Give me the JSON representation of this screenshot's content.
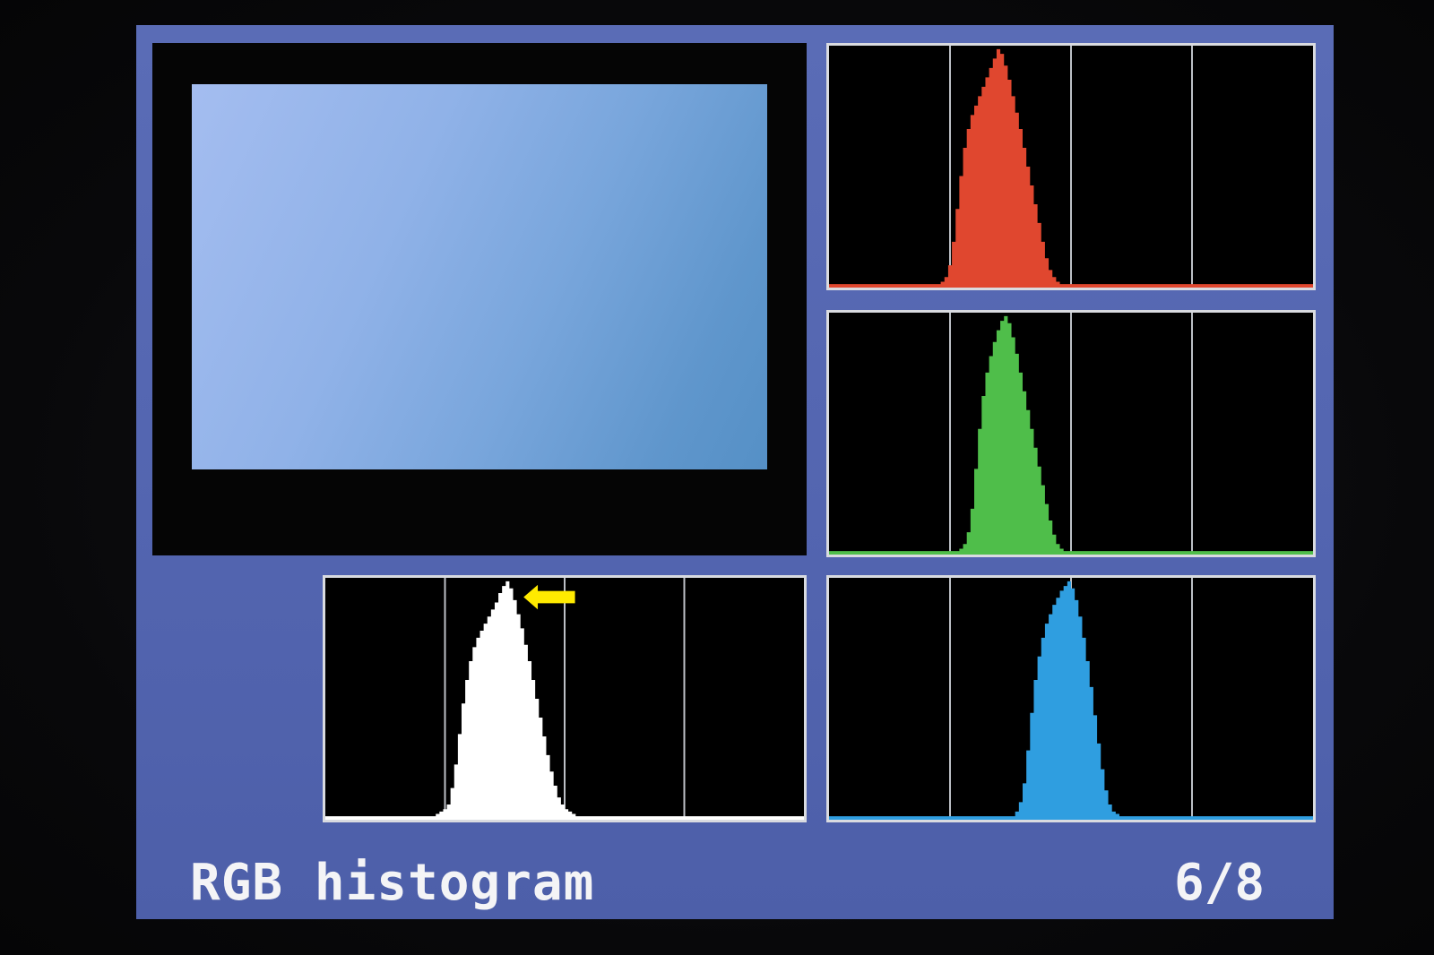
{
  "screen": {
    "title": "RGB histogram",
    "page_indicator": "6/8"
  },
  "colors": {
    "screen_bg": "#5565b0",
    "luminance": "#ffffff",
    "red": "#e0472f",
    "green": "#4fbe4a",
    "blue": "#2f9ee0",
    "peak_marker": "#ffea00",
    "gridline": "#bfc2c8",
    "panel_border": "#d9dbe0"
  },
  "histograms": [
    {
      "channel": "luminance",
      "color": "#ffffff",
      "bins": [
        0,
        0,
        0,
        0,
        0,
        0,
        0,
        0,
        0,
        0,
        0,
        0,
        0,
        0,
        0,
        0,
        0,
        0,
        0,
        0,
        0,
        0,
        0,
        0,
        0,
        0,
        0,
        0,
        0,
        0,
        0.01,
        0.02,
        0.03,
        0.05,
        0.12,
        0.22,
        0.35,
        0.48,
        0.58,
        0.66,
        0.72,
        0.76,
        0.79,
        0.82,
        0.85,
        0.88,
        0.91,
        0.95,
        0.98,
        1.0,
        0.97,
        0.92,
        0.86,
        0.8,
        0.73,
        0.66,
        0.58,
        0.5,
        0.42,
        0.34,
        0.26,
        0.19,
        0.13,
        0.08,
        0.05,
        0.03,
        0.02,
        0.01,
        0,
        0,
        0,
        0,
        0,
        0,
        0,
        0,
        0,
        0,
        0,
        0,
        0,
        0,
        0,
        0,
        0,
        0,
        0,
        0,
        0,
        0,
        0,
        0,
        0,
        0,
        0,
        0,
        0,
        0,
        0,
        0,
        0,
        0,
        0,
        0,
        0,
        0,
        0,
        0,
        0,
        0,
        0,
        0,
        0,
        0,
        0,
        0,
        0,
        0,
        0,
        0,
        0,
        0,
        0,
        0,
        0,
        0,
        0,
        0,
        0,
        0
      ]
    },
    {
      "channel": "red",
      "color": "#e0472f",
      "bins": [
        0,
        0,
        0,
        0,
        0,
        0,
        0,
        0,
        0,
        0,
        0,
        0,
        0,
        0,
        0,
        0,
        0,
        0,
        0,
        0,
        0,
        0,
        0,
        0,
        0,
        0,
        0,
        0,
        0,
        0,
        0.01,
        0.03,
        0.08,
        0.18,
        0.32,
        0.46,
        0.58,
        0.66,
        0.72,
        0.76,
        0.8,
        0.84,
        0.88,
        0.92,
        0.96,
        1.0,
        0.98,
        0.93,
        0.87,
        0.8,
        0.73,
        0.66,
        0.58,
        0.5,
        0.42,
        0.34,
        0.26,
        0.18,
        0.11,
        0.06,
        0.03,
        0.01,
        0,
        0,
        0,
        0,
        0,
        0,
        0,
        0,
        0,
        0,
        0,
        0,
        0,
        0,
        0,
        0,
        0,
        0,
        0,
        0,
        0,
        0,
        0,
        0,
        0,
        0,
        0,
        0,
        0,
        0,
        0,
        0,
        0,
        0,
        0,
        0,
        0,
        0,
        0,
        0,
        0,
        0,
        0,
        0,
        0,
        0,
        0,
        0,
        0,
        0,
        0,
        0,
        0,
        0,
        0,
        0,
        0,
        0,
        0,
        0,
        0,
        0,
        0,
        0,
        0,
        0,
        0,
        0
      ]
    },
    {
      "channel": "green",
      "color": "#4fbe4a",
      "bins": [
        0,
        0,
        0,
        0,
        0,
        0,
        0,
        0,
        0,
        0,
        0,
        0,
        0,
        0,
        0,
        0,
        0,
        0,
        0,
        0,
        0,
        0,
        0,
        0,
        0,
        0,
        0,
        0,
        0,
        0,
        0,
        0,
        0,
        0,
        0,
        0.01,
        0.03,
        0.08,
        0.18,
        0.35,
        0.52,
        0.66,
        0.76,
        0.83,
        0.89,
        0.94,
        0.98,
        1.0,
        0.97,
        0.91,
        0.84,
        0.76,
        0.68,
        0.6,
        0.52,
        0.44,
        0.36,
        0.28,
        0.2,
        0.13,
        0.07,
        0.03,
        0.01,
        0,
        0,
        0,
        0,
        0,
        0,
        0,
        0,
        0,
        0,
        0,
        0,
        0,
        0,
        0,
        0,
        0,
        0,
        0,
        0,
        0,
        0,
        0,
        0,
        0,
        0,
        0,
        0,
        0,
        0,
        0,
        0,
        0,
        0,
        0,
        0,
        0,
        0,
        0,
        0,
        0,
        0,
        0,
        0,
        0,
        0,
        0,
        0,
        0,
        0,
        0,
        0,
        0,
        0,
        0,
        0,
        0,
        0,
        0,
        0,
        0,
        0,
        0,
        0,
        0,
        0,
        0
      ]
    },
    {
      "channel": "blue",
      "color": "#2f9ee0",
      "bins": [
        0,
        0,
        0,
        0,
        0,
        0,
        0,
        0,
        0,
        0,
        0,
        0,
        0,
        0,
        0,
        0,
        0,
        0,
        0,
        0,
        0,
        0,
        0,
        0,
        0,
        0,
        0,
        0,
        0,
        0,
        0,
        0,
        0,
        0,
        0,
        0,
        0,
        0,
        0,
        0,
        0,
        0,
        0,
        0,
        0,
        0,
        0,
        0,
        0,
        0,
        0.02,
        0.06,
        0.14,
        0.28,
        0.44,
        0.58,
        0.68,
        0.76,
        0.82,
        0.86,
        0.9,
        0.93,
        0.96,
        0.98,
        1.0,
        0.97,
        0.92,
        0.85,
        0.76,
        0.66,
        0.55,
        0.43,
        0.31,
        0.2,
        0.11,
        0.05,
        0.02,
        0.01,
        0,
        0,
        0,
        0,
        0,
        0,
        0,
        0,
        0,
        0,
        0,
        0,
        0,
        0,
        0,
        0,
        0,
        0,
        0,
        0,
        0,
        0,
        0,
        0,
        0,
        0,
        0,
        0,
        0,
        0,
        0,
        0,
        0,
        0,
        0,
        0,
        0,
        0,
        0,
        0,
        0,
        0,
        0,
        0,
        0,
        0,
        0,
        0,
        0,
        0,
        0,
        0
      ]
    }
  ]
}
